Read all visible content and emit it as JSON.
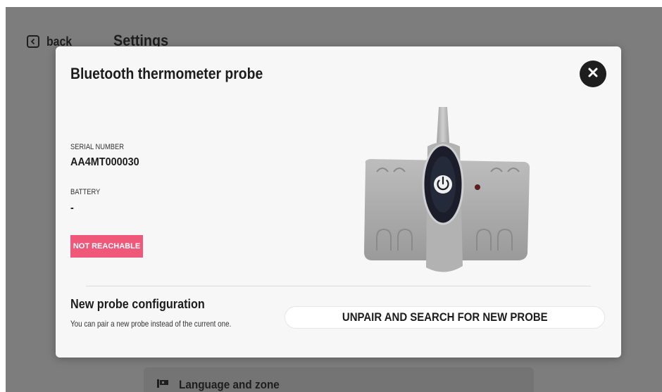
{
  "header": {
    "back_label": "back",
    "title": "Settings"
  },
  "background": {
    "item_label": "Language and zone",
    "item_icon": "language-flag-icon"
  },
  "modal": {
    "title": "Bluetooth thermometer probe",
    "close_icon": "close-icon",
    "serial_label": "SERIAL NUMBER",
    "serial_value": "AA4MT000030",
    "battery_label": "BATTERY",
    "battery_value": "-",
    "status_badge": "NOT REACHABLE",
    "status_color": "#f0587a",
    "probe_image": "bluetooth-probe-device",
    "config_title": "New probe configuration",
    "config_description": "You can pair a new probe instead of the current one.",
    "unpair_button": "UNPAIR AND SEARCH FOR NEW PROBE"
  }
}
